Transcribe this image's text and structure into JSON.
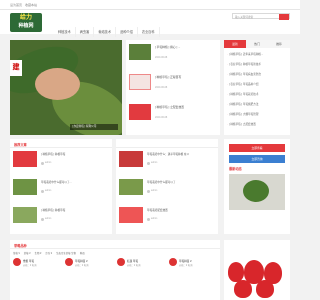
{
  "topbar": {
    "links": [
      "设为首页",
      "收藏本站"
    ]
  },
  "logo": {
    "line1": "给力",
    "line2": "种植网"
  },
  "search": {
    "placeholder": "输入关键词搜索"
  },
  "nav": [
    "种植技术",
    "病虫害",
    "栽培技术",
    "品种介绍",
    "农业百科"
  ],
  "hero": {
    "badge": "建",
    "caption": "[ 办定制莓 ] 驳利公司"
  },
  "news": [
    {
      "title": "[ 草莓种植 ] 摘心 ] ...",
      "date": "2020-06-08"
    },
    {
      "title": "[ 种植草莓 ] 正秘苗有",
      "date": "2020-06-08"
    },
    {
      "title": "[ 种植草莓 ] 之配套放置",
      "date": "2020-06-08"
    }
  ],
  "side": {
    "tabs": [
      "最新",
      "热门",
      "推荐"
    ],
    "items": [
      "[ 种植草莓 ] 近年来草莓种植...",
      "[ 农业草莓 ] 种植草莓新技术",
      "[ 种植草莓 ] 草莓病虫害防治",
      "[ 农业草莓 ] 草莓品种介绍",
      "[ 种植草莓 ] 草莓栽培技术",
      "[ 种植草莓 ] 草莓施肥方法",
      "[ 种植草莓 ] 大棚草莓管理",
      "[ 种植草莓 ] 之配套放置"
    ]
  },
  "mid": {
    "title": "推荐文章",
    "left": [
      {
        "title": "[ 种植草莓 ] 种植草莓",
        "user": "admin"
      },
      {
        "title": "草莓栽培中什么都可以了...",
        "user": "admin"
      },
      {
        "title": "[ 种植草莓 ] 种植草莓",
        "user": "admin"
      }
    ],
    "right": [
      {
        "title": "草莓栽培中什么：遂平草莓种植 在ㄨ",
        "user": "admin"
      },
      {
        "title": "草莓栽培中什么都可以了",
        "user": "admin"
      },
      {
        "title": "草莓栽培配套放置",
        "user": "admin"
      }
    ]
  },
  "right2": {
    "btn1": "立即查看",
    "btn2": "立即咨询",
    "caption": "最新动态"
  },
  "bottom": {
    "title": "草莓品种",
    "tags": [
      "草莓 ¥",
      "草莓 ¥",
      "生物 ¥",
      "冷冻 ¥",
      "生态冷冻草莓 生物",
      "种苗"
    ],
    "products": [
      {
        "name": "章姬 草莓",
        "desc": "价格：¥ 电询"
      },
      {
        "name": "草莓种苗 ¥",
        "desc": "价格：¥ 电询"
      },
      {
        "name": "红颜 草莓",
        "desc": "价格：¥ 电询"
      },
      {
        "name": "草莓种苗 ¥",
        "desc": "价格：¥ 电询"
      }
    ]
  },
  "colors": {
    "accent": "#e4393c",
    "blue": "#3b7fd1",
    "logo_bg": "#2d6a36"
  }
}
